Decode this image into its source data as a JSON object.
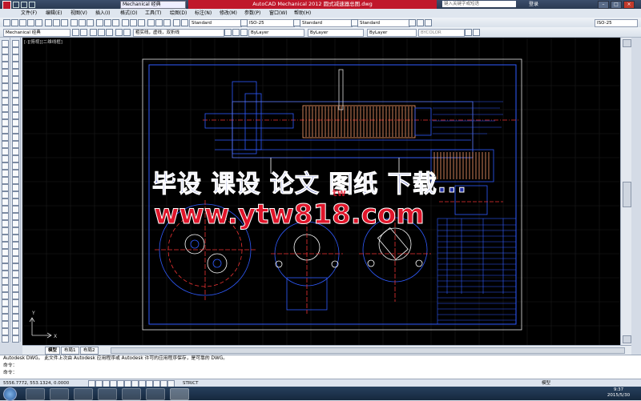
{
  "titlebar": {
    "workspace": "Mechanical 经典",
    "app_title": "AutoCAD Mechanical 2012    圆式减速器总图.dwg",
    "search_placeholder": "键入关键字或短语",
    "login": "登录"
  },
  "menu": [
    "文件(F)",
    "编辑(E)",
    "视图(V)",
    "插入(I)",
    "格式(O)",
    "工具(T)",
    "绘图(D)",
    "标注(N)",
    "修改(M)",
    "参数(P)",
    "窗口(W)",
    "帮助(H)"
  ],
  "toolbar2": {
    "text_style": "Standard",
    "dim_style": "ISO-25",
    "table_style": "Standard",
    "mleader_style": "Standard",
    "right_dim": "ISO-25"
  },
  "toolbar3": {
    "workspace": "Mechanical 经典",
    "layer": "粗实线，虚线，双折线",
    "color": "ByLayer",
    "linetype": "ByLayer",
    "lineweight": "ByLayer",
    "plotstyle": "BYCOLOR"
  },
  "viewport_label": "[-][俯视][二维线框]",
  "layout_tabs": [
    "模型",
    "布局1",
    "布局2"
  ],
  "command_lines": [
    "Autodesk DWG。  此文件上次由 Autodesk 应用程序或 Autodesk 许可的应用程序保存，是可靠的 DWG。",
    "命令：",
    "命令："
  ],
  "status": {
    "coordinates": "5556.7772, 553.1324, 0.0000",
    "model_label": "模型",
    "strict": "STRICT"
  },
  "clock": {
    "time": "9:37",
    "date": "2015/5/30"
  },
  "watermark": {
    "line1": "毕设 课设 论文 图纸 下载...",
    "line2": "www.ytw818.com",
    "small": "tw"
  },
  "ucs": {
    "x": "X",
    "y": "Y"
  },
  "colors": {
    "canvas": "#000000",
    "drawing_blue": "#2f5bff",
    "drawing_white": "#ffffff",
    "accent_red": "#c0182b"
  }
}
